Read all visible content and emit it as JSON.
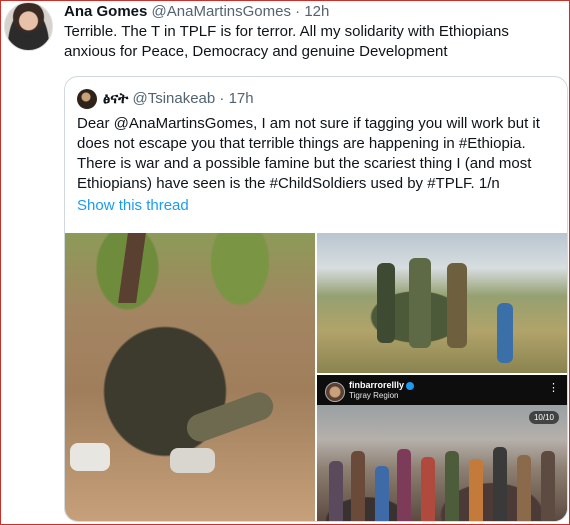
{
  "tweet": {
    "name": "Ana Gomes",
    "handle": "@AnaMartinsGomes",
    "separator": "·",
    "time": "12h",
    "text": "Terrible. The T in TPLF is for terror. All my solidarity with Ethiopians anxious for Peace, Democracy and genuine Development"
  },
  "quote": {
    "name": "ፅናት",
    "handle": "@Tsinakeab",
    "separator": "·",
    "time": "17h",
    "text": "Dear @AnaMartinsGomes, I am not sure if tagging you will work but it does not escape you that terrible things are happening in #Ethiopia. There is war and a possible famine but the scariest thing I (and most Ethiopians) have seen is the #ChildSoldiers used by #TPLF. 1/n",
    "show_thread": "Show this thread"
  },
  "embedded_post": {
    "username": "finbarrorellly",
    "location": "Tigray Region",
    "counter": "10/10",
    "more_glyph": "⋮"
  },
  "colors": {
    "link": "#1d9bf0",
    "text": "#0f1419",
    "muted": "#536471",
    "border": "#cfd9de",
    "frame": "#c9302c"
  },
  "icons": [
    "profile-avatar",
    "quote-avatar",
    "verified-badge-icon",
    "more-options-icon"
  ]
}
